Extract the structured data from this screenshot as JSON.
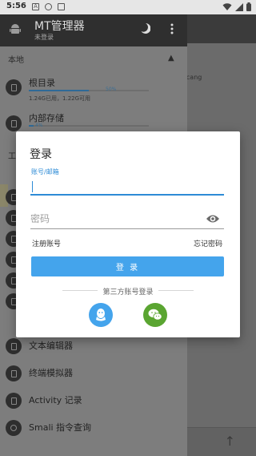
{
  "status_bar": {
    "time": "5:56"
  },
  "drawer": {
    "app_title": "MT管理器",
    "app_subtitle": "未登录",
    "section_local": "本地",
    "section_tools": "工",
    "storage": [
      {
        "label": "根目录",
        "meta": "1.24G已用，1.22G可用",
        "percent_text": "50%",
        "percent": 0.5
      },
      {
        "label": "内部存储",
        "meta": "",
        "percent_text": "4%",
        "percent": 0.04
      }
    ],
    "tools": [
      {
        "label": "文本编辑器",
        "icon": "document-icon"
      },
      {
        "label": "终端模拟器",
        "icon": "terminal-icon"
      },
      {
        "label": "Activity 记录",
        "icon": "activity-icon"
      },
      {
        "label": "Smali 指令查询",
        "icon": "search-icon"
      }
    ]
  },
  "background_app": {
    "text": "acang"
  },
  "dialog": {
    "title": "登录",
    "account_label": "账号/邮箱",
    "account_value": "",
    "password_placeholder": "密码",
    "register_label": "注册账号",
    "forgot_label": "忘记密码",
    "login_button": "登 录",
    "third_party_label": "第三方账号登录"
  },
  "colors": {
    "accent": "#44a4ec",
    "qq": "#44a4ec",
    "wechat": "#5aa531"
  }
}
